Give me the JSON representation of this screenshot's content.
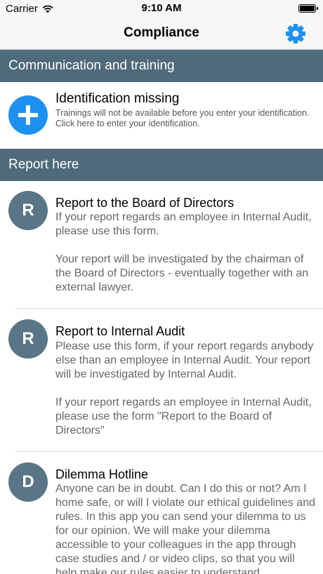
{
  "status_bar": {
    "carrier": "Carrier",
    "time": "9:10 AM"
  },
  "nav": {
    "title": "Compliance",
    "settings_icon": "gear-icon",
    "accent_color": "#1e90f0"
  },
  "sections": {
    "communication": "Communication and training",
    "report": "Report here"
  },
  "identification": {
    "title": "Identification missing",
    "line1": "Trainings will not be available before you enter your identification.",
    "line2": "Click here to enter your identification."
  },
  "reports": [
    {
      "letter": "R",
      "title": "Report to the Board of Directors",
      "description": "If your report regards an employee in Internal Audit, please use this form.\n\nYour report will be investigated by the chairman of the Board of Directors - eventually together with an external lawyer."
    },
    {
      "letter": "R",
      "title": "Report to Internal Audit",
      "description": "Please use this form, if your report regards anybody else than an employee in Internal Audit. Your report will be investigated by Internal Audit.\n\nIf your report regards an employee in Internal Audit, please use the form \"Report to the Board of Directors\""
    },
    {
      "letter": "D",
      "title": "Dilemma Hotline",
      "description": "Anyone can be in doubt. Can I do this or not? Am I home safe, or will I violate our ethical guidelines and rules. In this app you can send your dilemma to us for our opinion. We will make your dilemma accessible to your colleagues in the app through case studies and / or video clips, so that you will help make our rules easier to understand"
    }
  ],
  "colors": {
    "section_header": "#4f6a7a",
    "avatar": "#5a7585",
    "plus_button": "#1e90f0"
  }
}
